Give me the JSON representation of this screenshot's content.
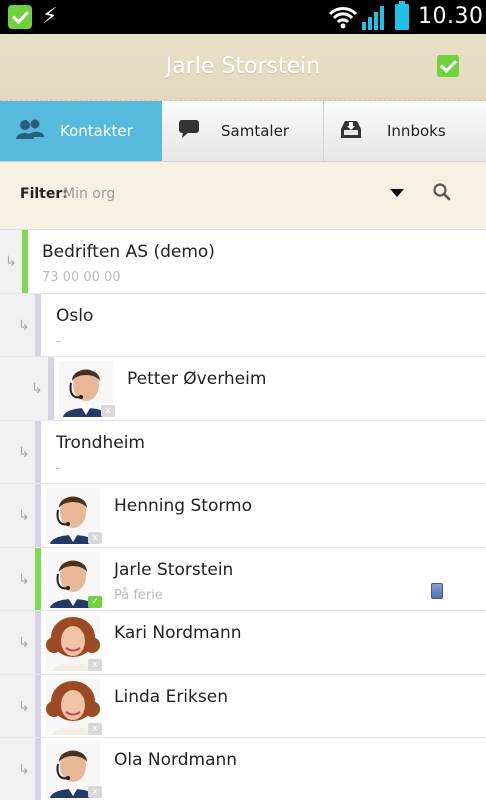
{
  "status_bar": {
    "time": "10.30"
  },
  "header": {
    "title": "Jarle Storstein"
  },
  "tabs": [
    {
      "label": "Kontakter",
      "icon": "contacts-icon",
      "active": true
    },
    {
      "label": "Samtaler",
      "icon": "chat-icon",
      "active": false
    },
    {
      "label": "Innboks",
      "icon": "inbox-icon",
      "active": false
    }
  ],
  "filter": {
    "label": "Filter:",
    "value": "Min org"
  },
  "list": [
    {
      "type": "org",
      "name": "Bedriften AS (demo)",
      "subtitle": "73 00 00 00",
      "level": 0,
      "accent": "#7ed957"
    },
    {
      "type": "org",
      "name": "Oslo",
      "subtitle": "-",
      "level": 1,
      "accent": "#d7d2e6"
    },
    {
      "type": "person",
      "name": "Petter Øverheim",
      "subtitle": "",
      "level": 2,
      "accent": "#d7d2e6",
      "presence": "x",
      "avatar": "man-headset"
    },
    {
      "type": "org",
      "name": "Trondheim",
      "subtitle": "-",
      "level": 1,
      "accent": "#d7d2e6"
    },
    {
      "type": "person",
      "name": "Henning Stormo",
      "subtitle": "",
      "level": 1,
      "accent": "#d7d2e6",
      "presence": "x",
      "avatar": "man-headset"
    },
    {
      "type": "person",
      "name": "Jarle Storstein",
      "subtitle": "På ferie",
      "level": 1,
      "accent": "#7ed957",
      "presence": "ok",
      "avatar": "man-headset",
      "device": "mobile-phone-icon"
    },
    {
      "type": "person",
      "name": "Kari Nordmann",
      "subtitle": "",
      "level": 1,
      "accent": "#d7d2e6",
      "presence": "x",
      "avatar": "woman-curly"
    },
    {
      "type": "person",
      "name": "Linda Eriksen",
      "subtitle": "",
      "level": 1,
      "accent": "#d7d2e6",
      "presence": "x",
      "avatar": "woman-curly"
    },
    {
      "type": "person",
      "name": "Ola Nordmann",
      "subtitle": "",
      "level": 1,
      "accent": "#d7d2e6",
      "presence": "x",
      "avatar": "man-headset"
    }
  ]
}
